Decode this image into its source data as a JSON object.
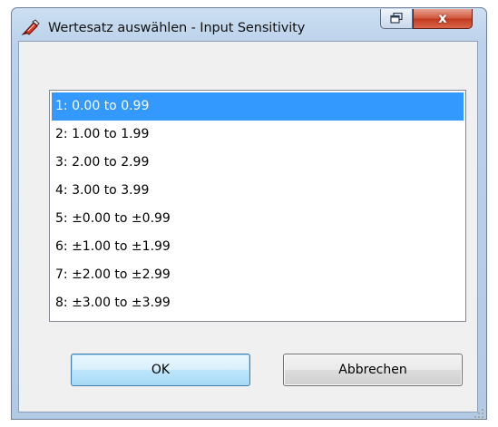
{
  "window": {
    "title": "Wertesatz auswählen - Input Sensitivity"
  },
  "titlebar": {
    "restore_icon": "restore-icon",
    "close_icon": "close-icon",
    "close_glyph": "x",
    "close_color": "#c7432a"
  },
  "list": {
    "selected_index": 0,
    "selection_color": "#3399ff",
    "items": [
      "1: 0.00 to 0.99",
      "2: 1.00 to 1.99",
      "3: 2.00 to 2.99",
      "4: 3.00 to 3.99",
      "5: ±0.00 to ±0.99",
      "6: ±1.00 to ±1.99",
      "7: ±2.00 to ±2.99",
      "8: ±3.00 to ±3.99"
    ]
  },
  "buttons": {
    "ok_label": "OK",
    "cancel_label": "Abbrechen"
  }
}
